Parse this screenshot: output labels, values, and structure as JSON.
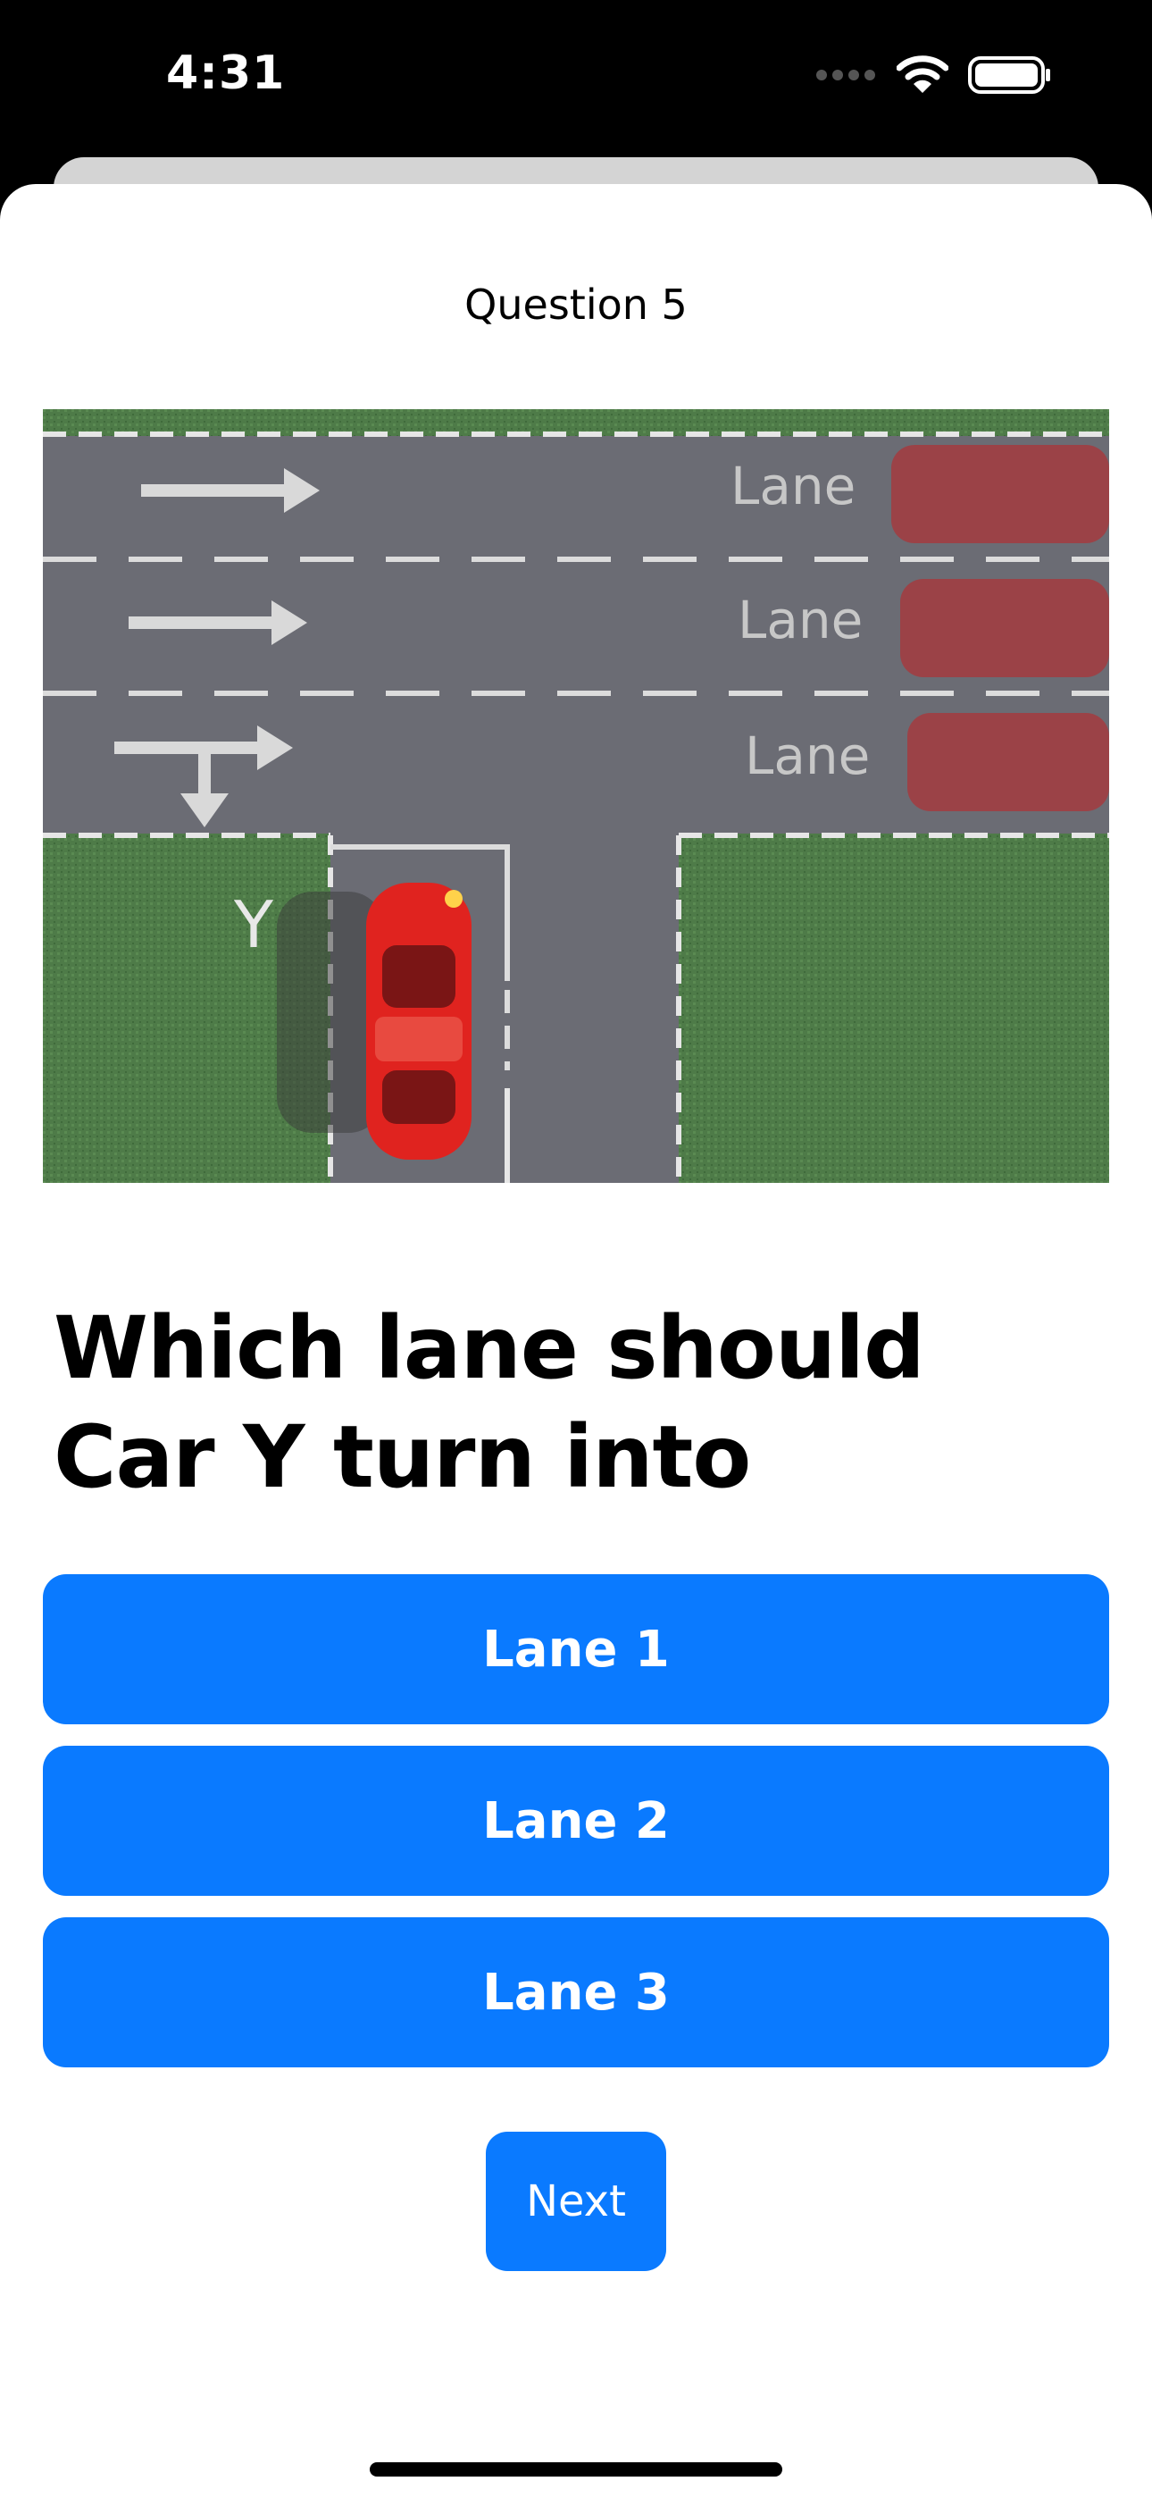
{
  "status_bar": {
    "time": "4:31",
    "icons": [
      "signal-dots-icon",
      "wifi-icon",
      "battery-icon"
    ]
  },
  "quiz": {
    "question_number": "Question 5",
    "question": "Which lane should Car Y turn into",
    "image": {
      "lane_labels": [
        "Lane",
        "Lane",
        "Lane"
      ],
      "car_label": "Y"
    },
    "answers": [
      "Lane 1",
      "Lane 2",
      "Lane 3"
    ],
    "next_label": "Next"
  },
  "colors": {
    "accent": "#0a7aff",
    "background": "#ffffff",
    "status_bar": "#000000"
  }
}
